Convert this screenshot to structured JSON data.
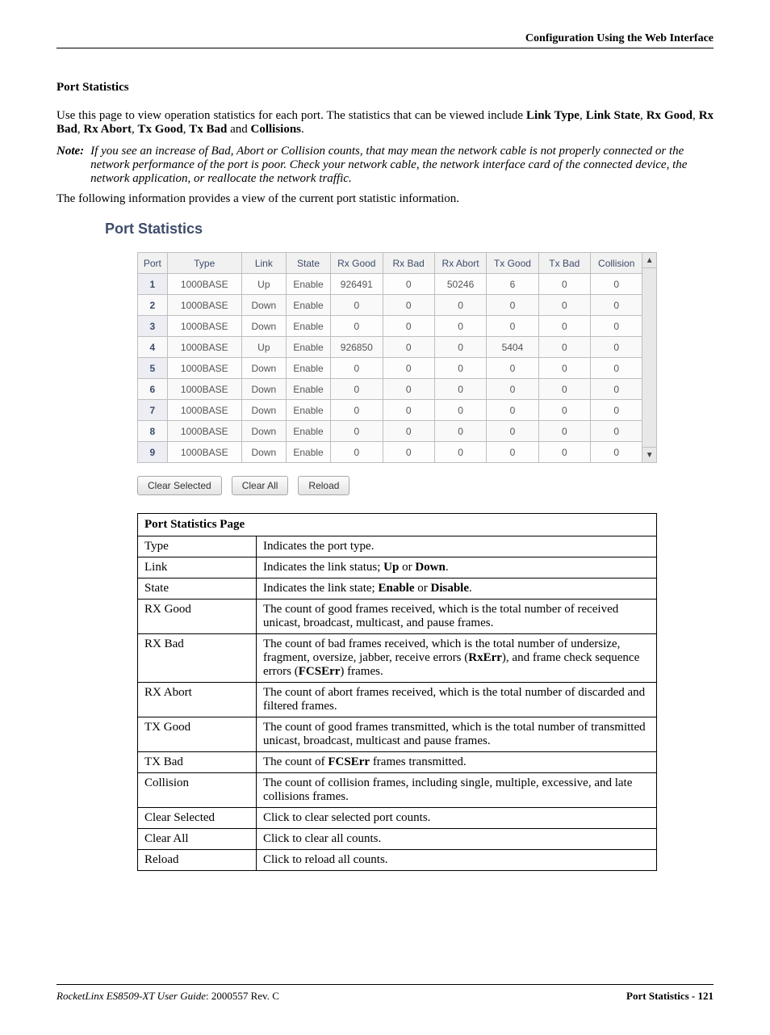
{
  "page": {
    "header_right": "Configuration Using the Web Interface",
    "section_title": "Port Statistics",
    "intro_1_a": "Use this page to view operation statistics for each port. The statistics that can be viewed include ",
    "intro_1_terms": [
      "Link Type",
      "Link State",
      "Rx Good",
      "Rx Bad",
      "Rx Abort",
      "Tx Good",
      "Tx Bad"
    ],
    "intro_1_last": "Collisions",
    "note_label": "Note:",
    "note_body": "If you see an increase of Bad, Abort or Collision counts, that may mean the network cable is not properly connected or the network performance of the port is poor. Check your network cable, the network interface card of the connected device, the network application, or reallocate the network traffic.",
    "intro_2": "The following information provides a view of the current port statistic information.",
    "panel_title": "Port Statistics"
  },
  "stats_table": {
    "headers": [
      "Port",
      "Type",
      "Link",
      "State",
      "Rx Good",
      "Rx Bad",
      "Rx Abort",
      "Tx Good",
      "Tx Bad",
      "Collision"
    ],
    "rows": [
      {
        "port": "1",
        "type": "1000BASE",
        "link": "Up",
        "state": "Enable",
        "rxg": "926491",
        "rxb": "0",
        "rxa": "50246",
        "txg": "6",
        "txb": "0",
        "col": "0"
      },
      {
        "port": "2",
        "type": "1000BASE",
        "link": "Down",
        "state": "Enable",
        "rxg": "0",
        "rxb": "0",
        "rxa": "0",
        "txg": "0",
        "txb": "0",
        "col": "0"
      },
      {
        "port": "3",
        "type": "1000BASE",
        "link": "Down",
        "state": "Enable",
        "rxg": "0",
        "rxb": "0",
        "rxa": "0",
        "txg": "0",
        "txb": "0",
        "col": "0"
      },
      {
        "port": "4",
        "type": "1000BASE",
        "link": "Up",
        "state": "Enable",
        "rxg": "926850",
        "rxb": "0",
        "rxa": "0",
        "txg": "5404",
        "txb": "0",
        "col": "0"
      },
      {
        "port": "5",
        "type": "1000BASE",
        "link": "Down",
        "state": "Enable",
        "rxg": "0",
        "rxb": "0",
        "rxa": "0",
        "txg": "0",
        "txb": "0",
        "col": "0"
      },
      {
        "port": "6",
        "type": "1000BASE",
        "link": "Down",
        "state": "Enable",
        "rxg": "0",
        "rxb": "0",
        "rxa": "0",
        "txg": "0",
        "txb": "0",
        "col": "0"
      },
      {
        "port": "7",
        "type": "1000BASE",
        "link": "Down",
        "state": "Enable",
        "rxg": "0",
        "rxb": "0",
        "rxa": "0",
        "txg": "0",
        "txb": "0",
        "col": "0"
      },
      {
        "port": "8",
        "type": "1000BASE",
        "link": "Down",
        "state": "Enable",
        "rxg": "0",
        "rxb": "0",
        "rxa": "0",
        "txg": "0",
        "txb": "0",
        "col": "0"
      },
      {
        "port": "9",
        "type": "1000BASE",
        "link": "Down",
        "state": "Enable",
        "rxg": "0",
        "rxb": "0",
        "rxa": "0",
        "txg": "0",
        "txb": "0",
        "col": "0"
      }
    ]
  },
  "buttons": {
    "clear_selected": "Clear Selected",
    "clear_all": "Clear All",
    "reload": "Reload"
  },
  "desc_table": {
    "heading": "Port Statistics Page",
    "rows": [
      {
        "label": "Type",
        "text_a": "Indicates the port type.",
        "bold_parts": []
      },
      {
        "label": "Link",
        "text_a": "Indicates the link status; ",
        "bold_parts": [
          "Up",
          " or ",
          "Down",
          "."
        ]
      },
      {
        "label": "State",
        "text_a": "Indicates the link state; ",
        "bold_parts": [
          "Enable",
          " or ",
          "Disable",
          "."
        ]
      },
      {
        "label": "RX Good",
        "text_a": "The count of good frames received, which is the total number of received unicast, broadcast, multicast, and pause frames.",
        "bold_parts": []
      },
      {
        "label": "RX Bad",
        "text_a": "The count of bad frames received, which is the total number of undersize, fragment, oversize, jabber, receive errors (",
        "bold_parts": [
          "RxErr",
          "), and frame check sequence errors (",
          "FCSErr",
          ") frames."
        ]
      },
      {
        "label": "RX Abort",
        "text_a": "The count of abort frames received, which is the total number of discarded and filtered frames.",
        "bold_parts": []
      },
      {
        "label": "TX Good",
        "text_a": "The count of good frames transmitted, which is the total number of transmitted unicast, broadcast, multicast and pause frames.",
        "bold_parts": []
      },
      {
        "label": "TX Bad",
        "text_a": "The count of ",
        "bold_parts": [
          "FCSErr",
          " frames transmitted."
        ]
      },
      {
        "label": "Collision",
        "text_a": "The count of collision frames, including single, multiple, excessive, and late collisions frames.",
        "bold_parts": []
      },
      {
        "label": "Clear Selected",
        "text_a": "Click to clear selected port counts.",
        "bold_parts": []
      },
      {
        "label": "Clear All",
        "text_a": "Click to clear all counts.",
        "bold_parts": []
      },
      {
        "label": "Reload",
        "text_a": "Click to reload all counts.",
        "bold_parts": []
      }
    ]
  },
  "footer": {
    "left_em": "RocketLinx ES8509-XT User Guide",
    "left_rest": ": 2000557 Rev. C",
    "right_bold": "Port Statistics - 121"
  }
}
